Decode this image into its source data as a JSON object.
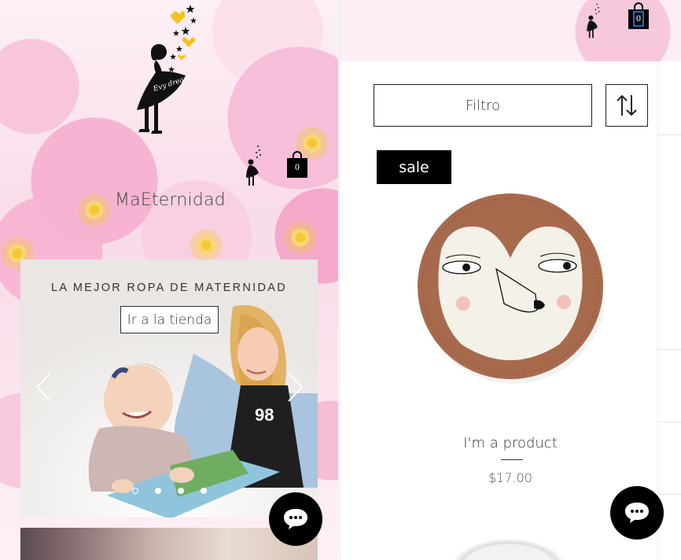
{
  "left_site": {
    "site_title": "MaEternidad",
    "logo_text": "Evy dream",
    "cart_count": "0",
    "hero": {
      "tagline": "LA MEJOR ROPA DE MATERNIDAD",
      "cta_label": "Ir a la tienda",
      "slide_count": 4,
      "active_slide": 1
    }
  },
  "right_site": {
    "cart_count": "0",
    "filter_label": "Filtro",
    "product": {
      "badge": "sale",
      "name": "I'm a product",
      "price": "$17.00"
    }
  },
  "colors": {
    "black": "#000000",
    "pink": "#f6b3d2",
    "text": "#333333"
  },
  "icons": [
    "girl-silhouette-icon",
    "shopping-bag-icon",
    "chevron-left-icon",
    "chevron-right-icon",
    "chat-icon",
    "sort-icon"
  ]
}
